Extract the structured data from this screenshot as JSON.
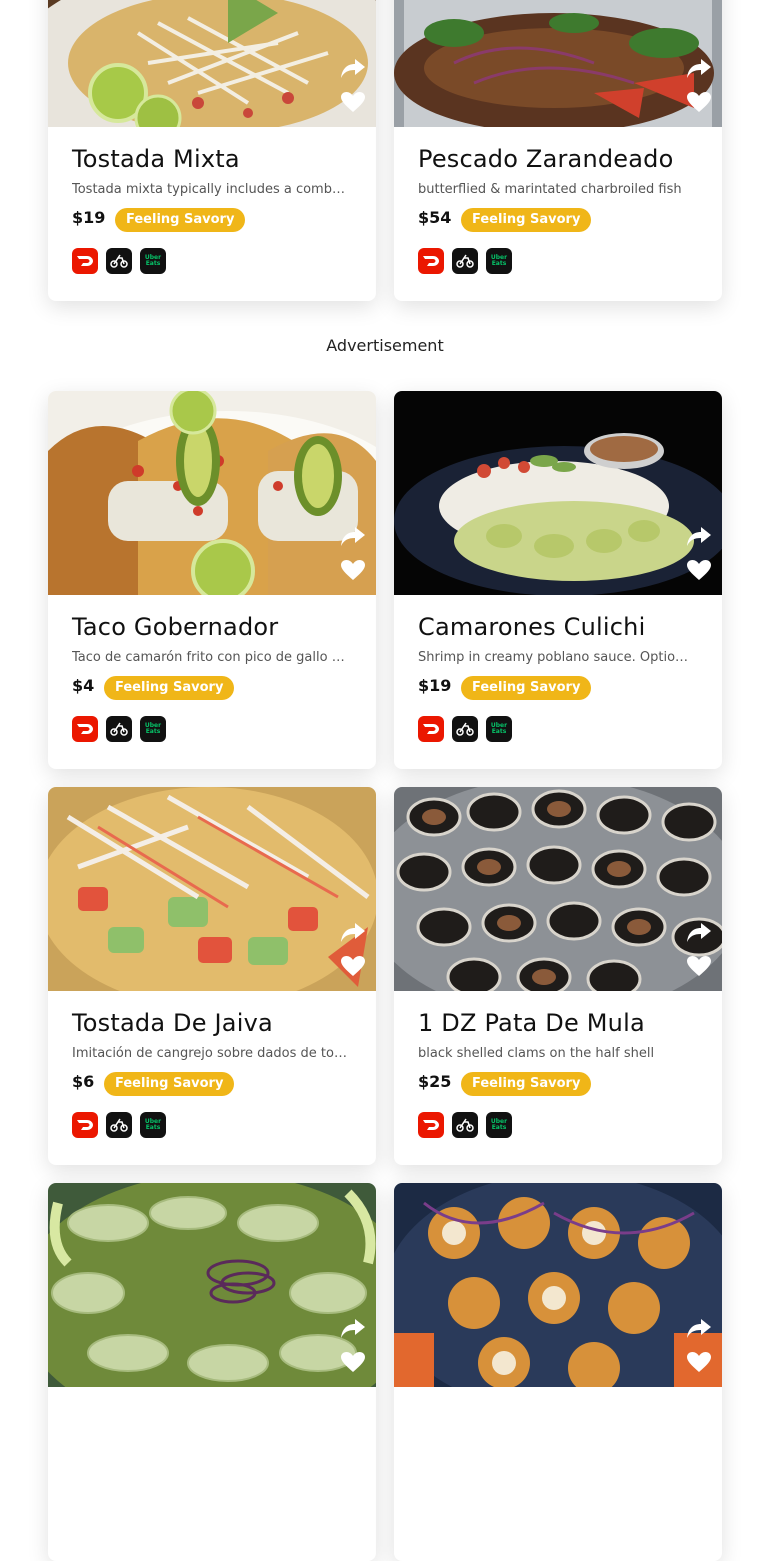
{
  "ad_label": "Advertisement",
  "delivery_services": [
    {
      "name": "DoorDash",
      "icon": "doordash-icon",
      "color": "#eb1700"
    },
    {
      "name": "Postmates",
      "icon": "postmates-icon",
      "color": "#111111"
    },
    {
      "name": "Uber Eats",
      "icon": "ubereats-icon",
      "color": "#111111",
      "label_line1": "Uber",
      "label_line2": "Eats"
    }
  ],
  "badge_color": "#f0b618",
  "cards": [
    {
      "title": "Tostada Mixta",
      "description": "Tostada mixta typically includes a combination of seafood such as shrimp, octopus and fish",
      "price": "$19",
      "badge": "Feeling Savory"
    },
    {
      "title": "Pescado Zarandeado",
      "description": "butterflied & marintated charbroiled fish",
      "price": "$54",
      "badge": "Feeling Savory"
    },
    {
      "title": "Taco Gobernador",
      "description": "Taco de camarón frito con pico de gallo y aguacate",
      "price": "$4",
      "badge": "Feeling Savory"
    },
    {
      "title": "Camarones Culichi",
      "description": "Shrimp in creamy poblano sauce. Optional rice and salad",
      "price": "$19",
      "badge": "Feeling Savory"
    },
    {
      "title": "Tostada De Jaiva",
      "description": "Imitación de cangrejo sobre dados de tomate y pepino",
      "price": "$6",
      "badge": "Feeling Savory"
    },
    {
      "title": "1 DZ Pata De Mula",
      "description": "black shelled clams on the half shell",
      "price": "$25",
      "badge": "Feeling Savory"
    },
    {
      "title": "",
      "description": "",
      "price": "",
      "badge": ""
    },
    {
      "title": "",
      "description": "",
      "price": "",
      "badge": ""
    }
  ]
}
